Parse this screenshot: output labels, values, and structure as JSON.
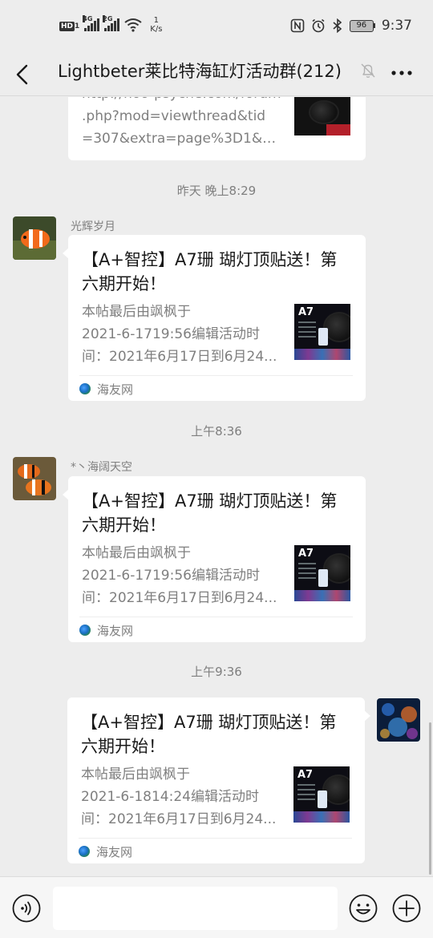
{
  "status_bar": {
    "hd": "HD",
    "hd_sub": "1",
    "net1": "4G",
    "net2": "2G",
    "speed_value": "1",
    "speed_unit": "K/s",
    "battery": "96",
    "time": "9:37"
  },
  "header": {
    "title": "Lightbeter莱比特海缸灯活动群(212)"
  },
  "messages": {
    "top_card": {
      "link_lines": [
        "http://noo-psyche.com/forum",
        ".php?mod=viewthread&tid",
        "=307&extra=page%3D1&mo..."
      ]
    },
    "ts1": "昨天 晚上8:29",
    "msg1": {
      "sender": "光辉岁月",
      "title": "【A+智控】A7珊 瑚灯顶贴送！第六期开始！",
      "desc_lines": [
        "本帖最后由飒枫于",
        "2021-6-1719:56编辑活动时",
        "间：2021年6月17日到6月24..."
      ],
      "source": "海友网",
      "thumb_label": "A7"
    },
    "ts2": "上午8:36",
    "msg2": {
      "sender": "*丶海阔天空",
      "title": "【A+智控】A7珊 瑚灯顶贴送！第六期开始！",
      "desc_lines": [
        "本帖最后由飒枫于",
        "2021-6-1719:56编辑活动时",
        "间：2021年6月17日到6月24..."
      ],
      "source": "海友网",
      "thumb_label": "A7"
    },
    "ts3": "上午9:36",
    "msg3": {
      "title": "【A+智控】A7珊 瑚灯顶贴送！第六期开始！",
      "desc_lines": [
        "本帖最后由飒枫于",
        "2021-6-1814:24编辑活动时",
        "间：2021年6月17日到6月24..."
      ],
      "source": "海友网",
      "thumb_label": "A7"
    }
  },
  "input": {
    "placeholder": ""
  },
  "icons": {
    "back": "back-arrow-icon",
    "mute": "bell-off-icon",
    "more": "more-dots-icon",
    "voice": "voice-icon",
    "emoji": "emoji-icon",
    "plus": "plus-icon"
  },
  "colors": {
    "background": "#ededed",
    "bubble": "#ffffff",
    "secondary_text": "#7f7f7f"
  }
}
